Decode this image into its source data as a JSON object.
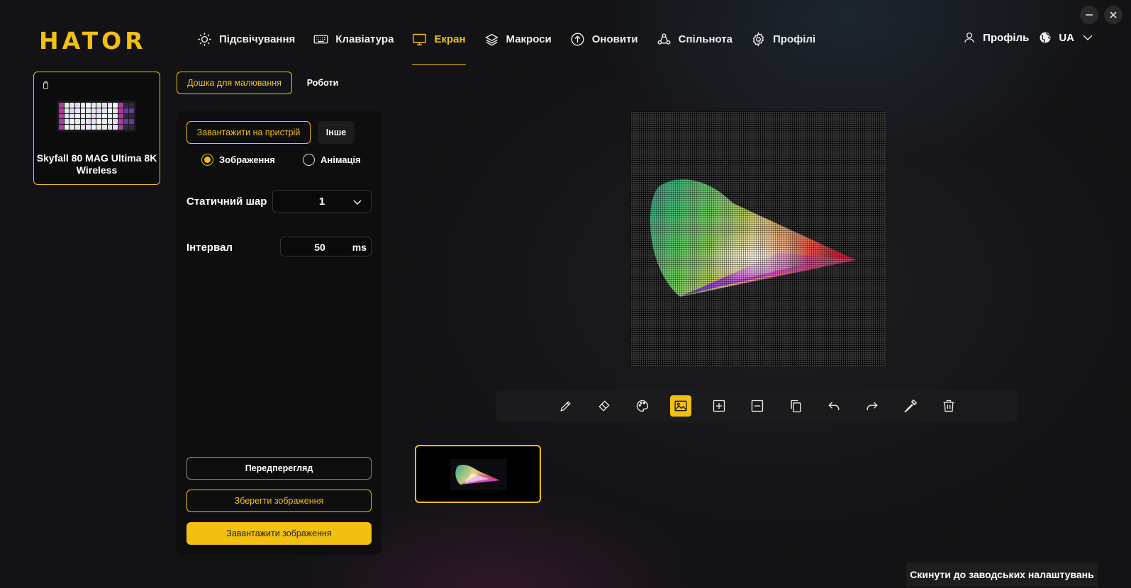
{
  "app": {
    "logo": "HATOR"
  },
  "window": {
    "minimize_icon": "minus-icon",
    "close_icon": "close-icon"
  },
  "nav": {
    "items": [
      {
        "label": "Підсвічування",
        "icon": "sun-icon"
      },
      {
        "label": "Клавіатура",
        "icon": "keyboard-icon"
      },
      {
        "label": "Екран",
        "icon": "monitor-icon",
        "active": true
      },
      {
        "label": "Макроси",
        "icon": "layers-icon"
      },
      {
        "label": "Оновити",
        "icon": "upload-circle-icon"
      },
      {
        "label": "Спільнота",
        "icon": "community-icon"
      },
      {
        "label": "Профілі",
        "icon": "gear-icon"
      }
    ],
    "profile_label": "Профіль",
    "language": "UA"
  },
  "device": {
    "name": "Skyfall 80 MAG Ultima 8K Wireless",
    "connection_icon": "usb-icon"
  },
  "tabs": {
    "draw": "Дошка для малювання",
    "works": "Роботи"
  },
  "panel": {
    "upload_device": "Завантажити на пристрій",
    "other": "Інше",
    "radio_image": "Зображення",
    "radio_animation": "Анімація",
    "selected_mode": "image",
    "static_layer_label": "Статичний шар",
    "static_layer_value": "1",
    "interval_label": "Інтервал",
    "interval_value": "50",
    "interval_unit": "ms",
    "preview_button": "Передперегляд",
    "save_image_button": "Зберегти зображення",
    "load_image_button": "Завантажити зображення"
  },
  "toolbar": {
    "tools": [
      "pencil-icon",
      "eraser-icon",
      "palette-icon",
      "image-icon",
      "zoom-in-icon",
      "zoom-out-icon",
      "copy-icon",
      "undo-icon",
      "redo-icon",
      "eyedropper-icon",
      "trash-icon"
    ],
    "active_tool": "image-icon"
  },
  "reset_button": "Скинути до заводських налаштувань",
  "colors": {
    "accent": "#f2c011",
    "background": "#131315",
    "panel": "#0e0e0f"
  }
}
